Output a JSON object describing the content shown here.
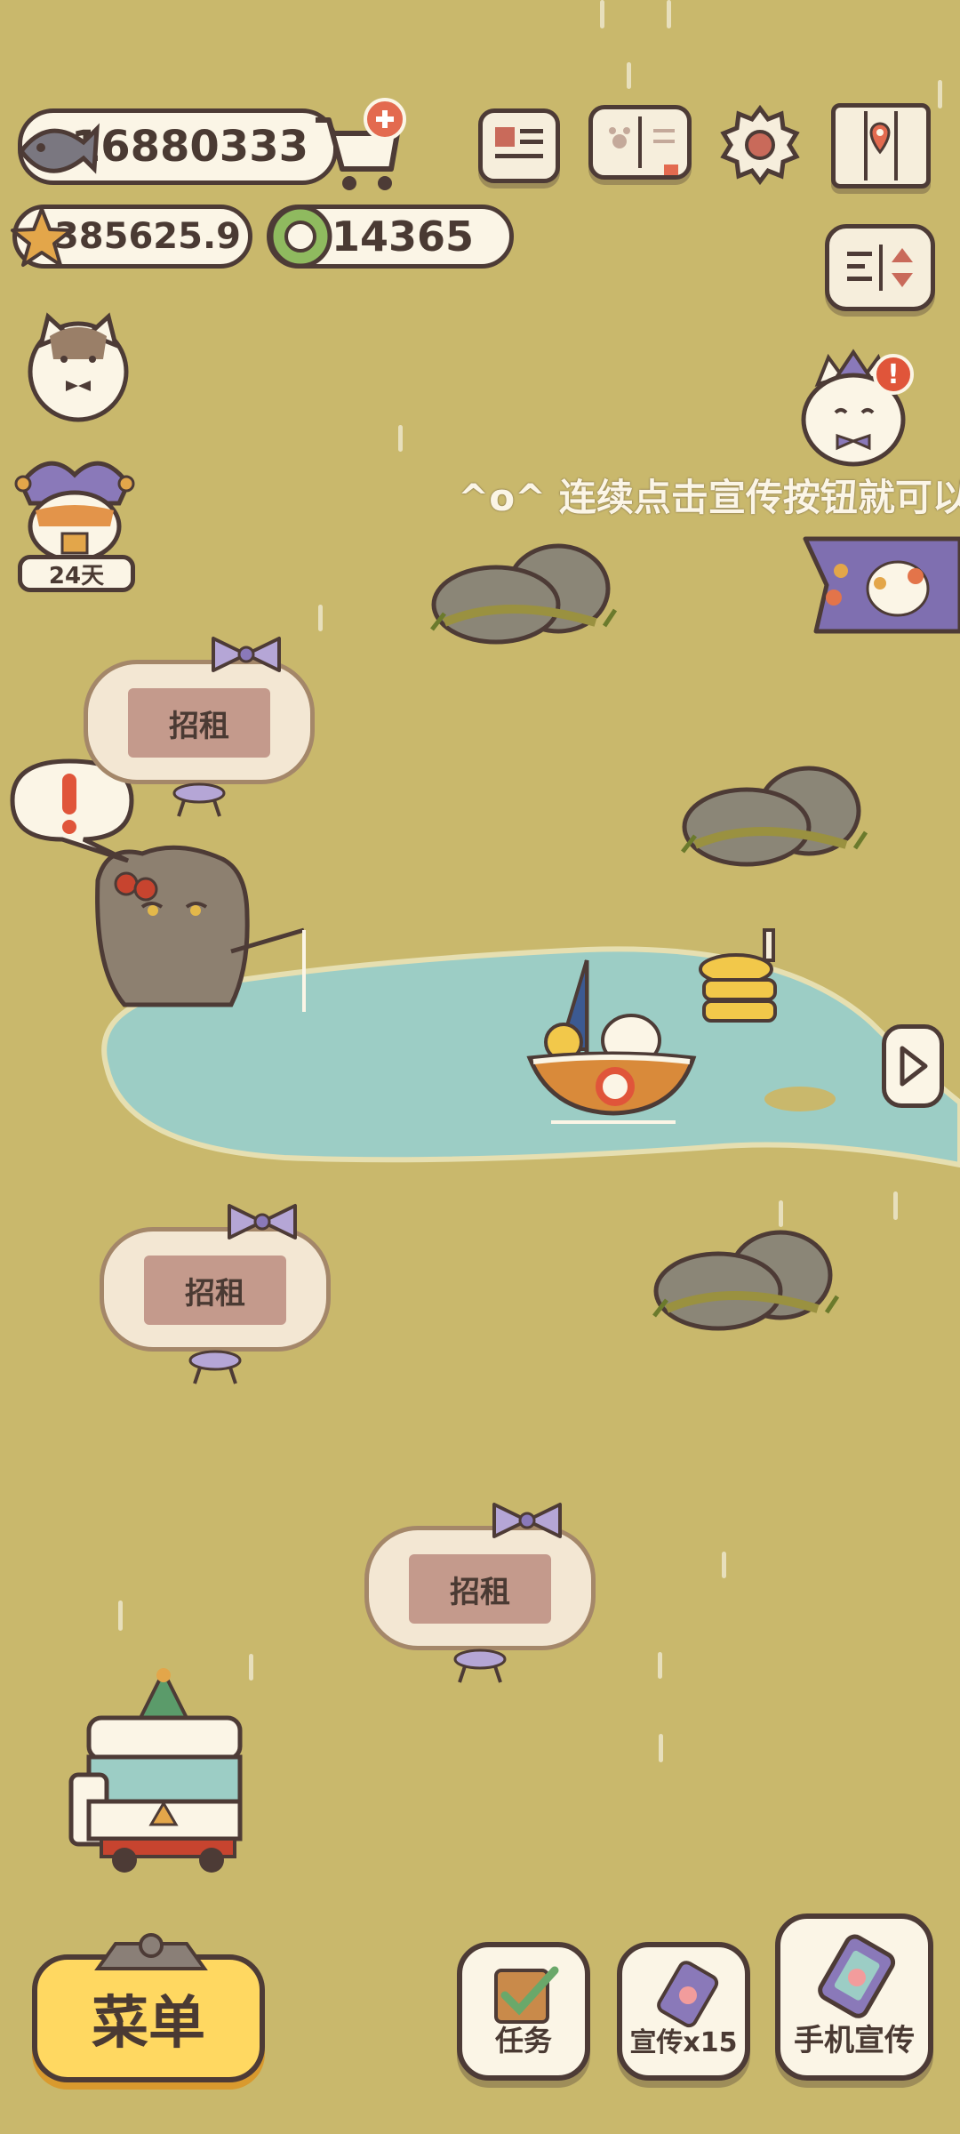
{
  "currency": {
    "fish": "16880333",
    "stars": "385625.9",
    "coins": "14365"
  },
  "top_icons": [
    "newspaper-icon",
    "cat-album-icon",
    "settings-gear-icon",
    "map-icon",
    "sort-toggle-icon"
  ],
  "badges": {
    "event_days": "24天",
    "exclamation": "!"
  },
  "ticker": {
    "text": "^o^ 连续点击宣传按钮就可以"
  },
  "rent_signs": [
    {
      "label": "招租"
    },
    {
      "label": "招租"
    },
    {
      "label": "招租"
    }
  ],
  "bottom_bar": {
    "menu_label": "菜单",
    "tasks_label": "任务",
    "promo_x15_label": "宣传x15",
    "phone_promo_label": "手机宣传"
  },
  "colors": {
    "ground": "#c9b86c",
    "water": "#9ccdc5",
    "outline": "#4d3b36",
    "menu_yellow": "#ffd861"
  }
}
